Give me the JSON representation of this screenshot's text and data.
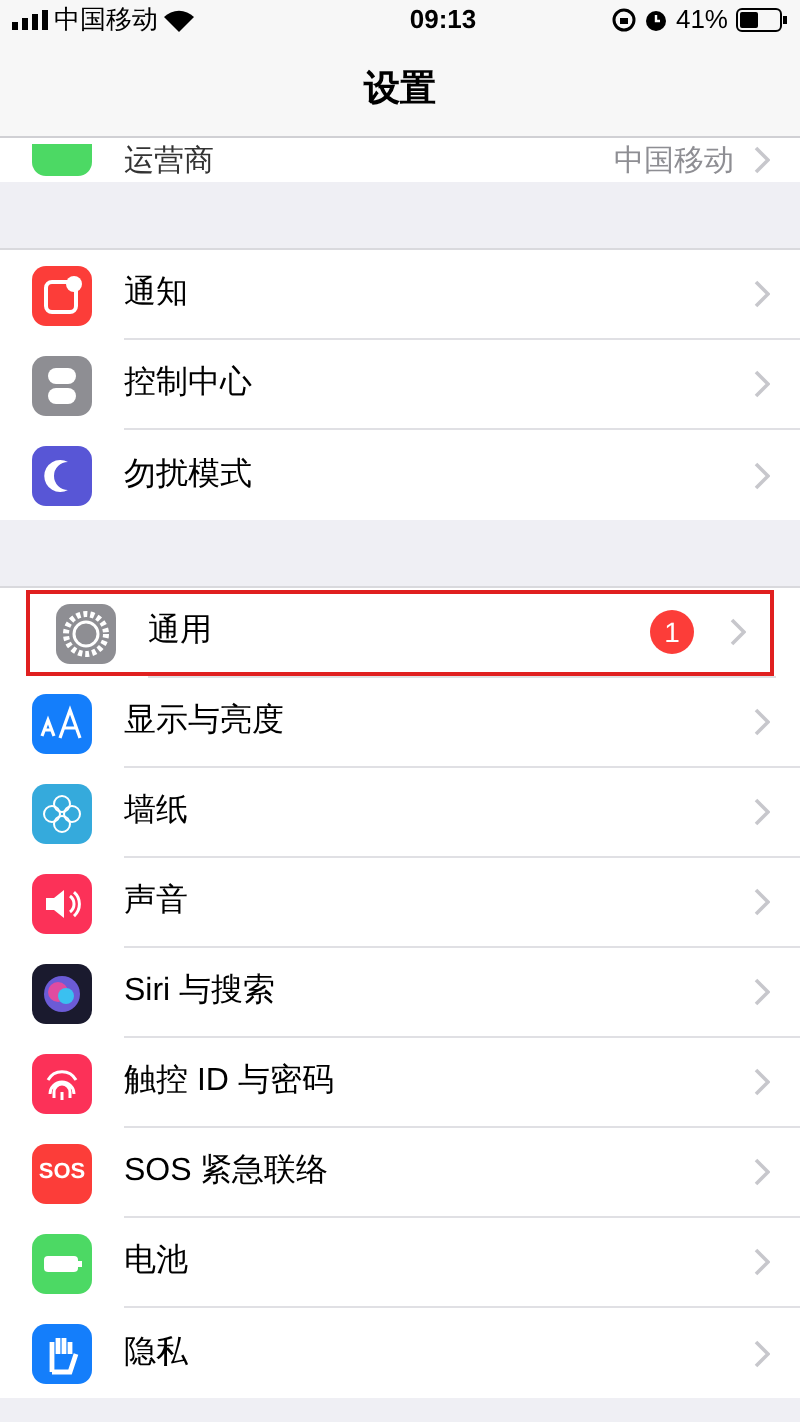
{
  "status_bar": {
    "carrier": "中国移动",
    "time": "09:13",
    "battery": "41%"
  },
  "nav_bar": {
    "title": "设置"
  },
  "partial_row": {
    "label": "运营商",
    "value": "中国移动"
  },
  "groups": [
    {
      "rows": [
        {
          "label": "通知"
        },
        {
          "label": "控制中心"
        },
        {
          "label": "勿扰模式"
        }
      ]
    },
    {
      "rows": [
        {
          "label": "通用",
          "badge": "1",
          "highlighted": true
        },
        {
          "label": "显示与亮度"
        },
        {
          "label": "墙纸"
        },
        {
          "label": "声音"
        },
        {
          "label": "Siri 与搜索"
        },
        {
          "label": "触控 ID 与密码"
        },
        {
          "label": "SOS 紧急联络",
          "icon_text": "SOS"
        },
        {
          "label": "电池"
        },
        {
          "label": "隐私"
        }
      ]
    }
  ]
}
